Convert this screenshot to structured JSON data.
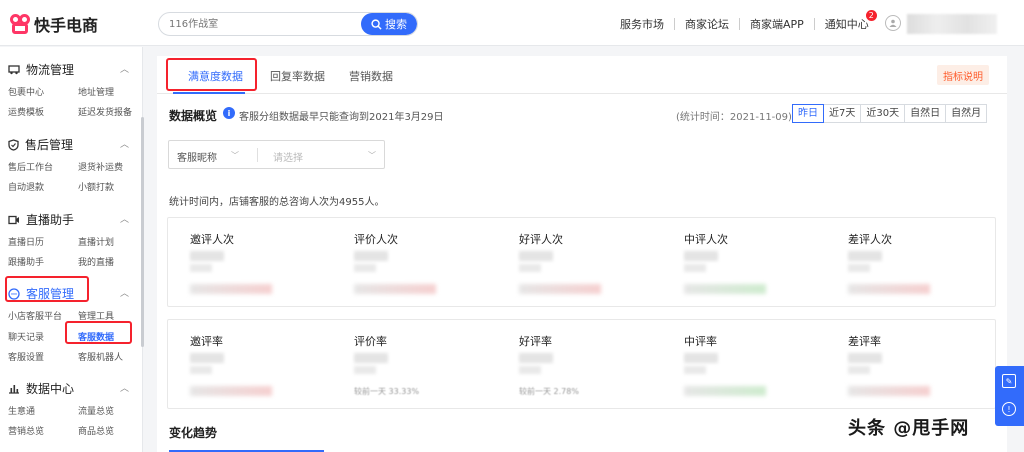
{
  "app": {
    "name": "快手电商"
  },
  "search": {
    "placeholder": "116作战室",
    "button_label": "搜索"
  },
  "top_links": [
    "服务市场",
    "商家论坛",
    "商家端APP",
    "通知中心"
  ],
  "notify_count": "2",
  "sidebar": {
    "sections": [
      {
        "label": "物流管理",
        "icon": "truck-icon",
        "items": [
          "包裹中心",
          "地址管理",
          "运费模板",
          "延迟发货报备"
        ]
      },
      {
        "label": "售后管理",
        "icon": "shield-icon",
        "items": [
          "售后工作台",
          "退货补运费",
          "自动退款",
          "小额打款"
        ]
      },
      {
        "label": "直播助手",
        "icon": "video-icon",
        "items": [
          "直播日历",
          "直播计划",
          "跟播助手",
          "我的直播"
        ]
      },
      {
        "label": "客服管理",
        "icon": "chat-icon",
        "items": [
          "小店客服平台",
          "管理工具",
          "聊天记录",
          "客服数据",
          "客服设置",
          "客服机器人"
        ]
      },
      {
        "label": "数据中心",
        "icon": "bar-chart-icon",
        "items": [
          "生意通",
          "流量总览",
          "营销总览",
          "商品总览"
        ]
      }
    ]
  },
  "tabs": [
    "满意度数据",
    "回复率数据",
    "营销数据"
  ],
  "explain_label": "指标说明",
  "overview": {
    "title": "数据概览",
    "info": "客服分组数据最早只能查询到2021年3月29日",
    "stat_time": "(统计时间：2021-11-09)",
    "ranges": [
      "昨日",
      "近7天",
      "近30天",
      "自然日",
      "自然月"
    ],
    "active_range": "昨日"
  },
  "filter": {
    "label": "客服昵称",
    "placeholder": "请选择"
  },
  "summary": "统计时间内，店铺客服的总咨询人次为4955人。",
  "metrics_row1": [
    "邀评人次",
    "评价人次",
    "好评人次",
    "中评人次",
    "差评人次"
  ],
  "metrics_row2": [
    "邀评率",
    "评价率",
    "好评率",
    "中评率",
    "差评率"
  ],
  "mini_labels": [
    "较前一天 33.33%",
    "较前一天 2.78%"
  ],
  "trend_title": "变化趋势",
  "watermark": "头条 @甩手网",
  "colors": {
    "accent": "#326bfb",
    "highlight": "#f5222d",
    "brand": "#fe3666"
  }
}
